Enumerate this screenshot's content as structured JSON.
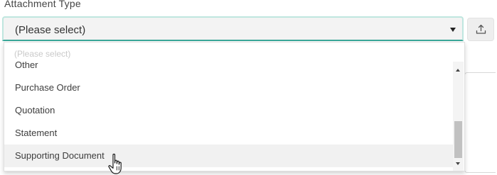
{
  "field": {
    "label": "Attachment Type"
  },
  "select": {
    "value": "(Please select)"
  },
  "dropdown": {
    "placeholder_option": "(Please select)",
    "options": [
      "Other",
      "Purchase Order",
      "Quotation",
      "Statement",
      "Supporting Document"
    ],
    "hovered_option": "Supporting Document"
  },
  "icons": {
    "upload": "upload-icon",
    "caret": "caret-down-icon",
    "cursor": "hand-pointer-cursor"
  },
  "colors": {
    "accent": "#3aa89a",
    "focus_border": "#bfe6df",
    "hover_bg": "#f1f1f1"
  }
}
